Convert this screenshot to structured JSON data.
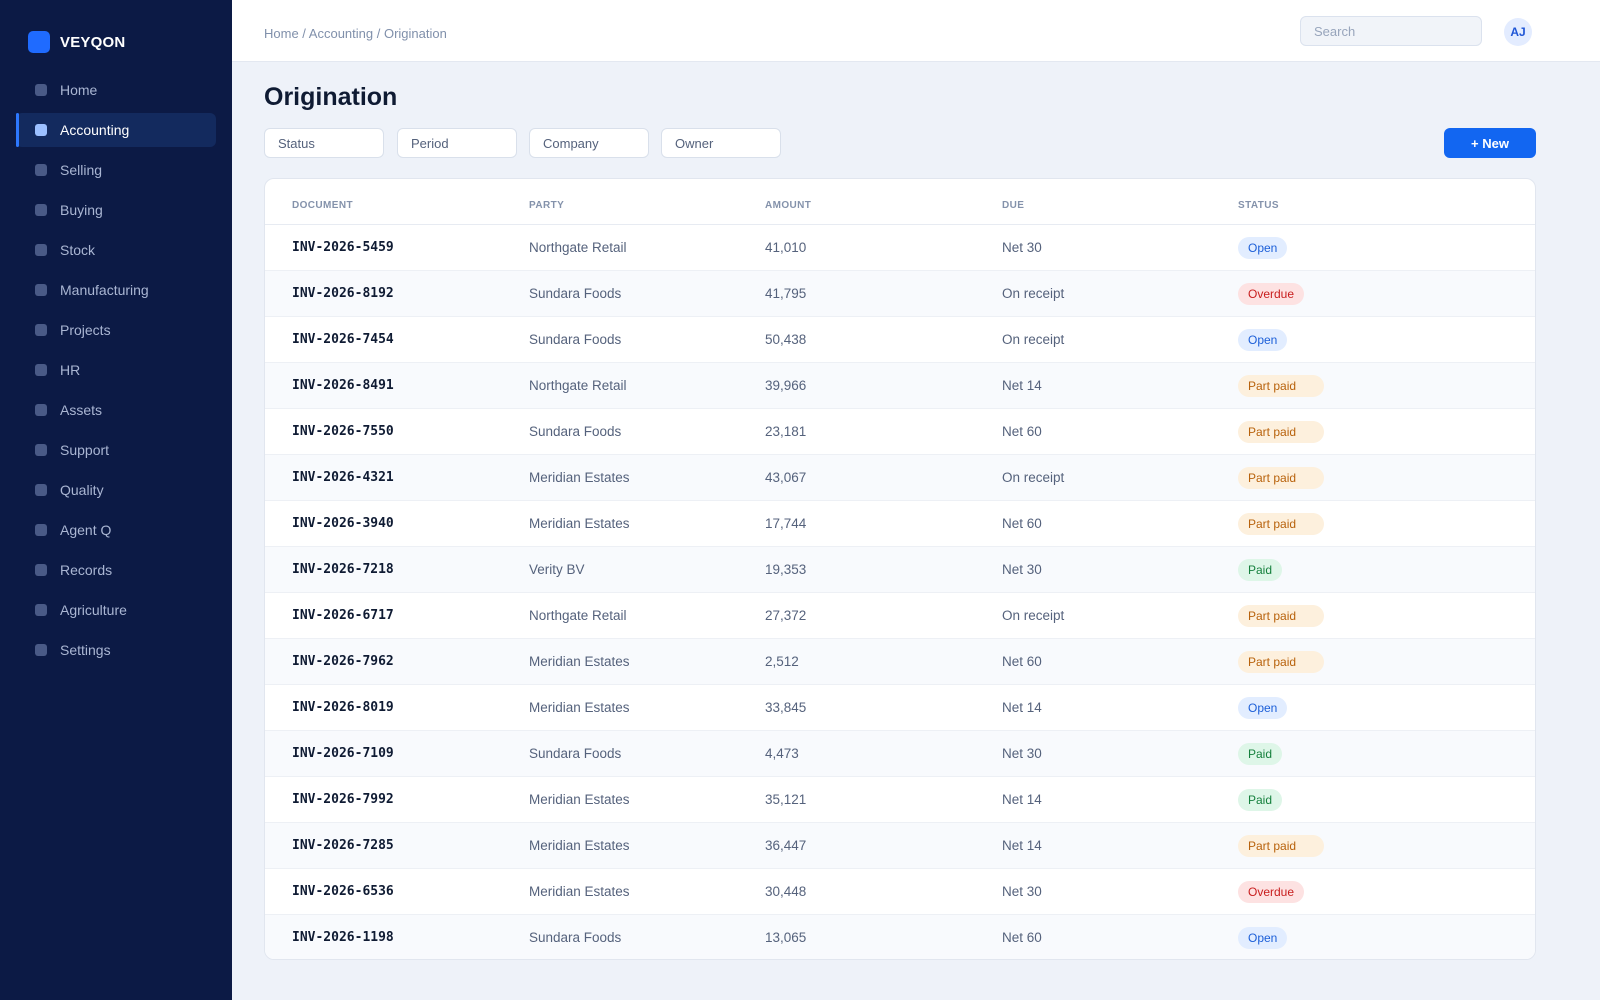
{
  "brand": {
    "name": "VEYQON",
    "accent": "#1f6bff"
  },
  "sidebar": {
    "active": "Accounting",
    "items": [
      {
        "label": "Home"
      },
      {
        "label": "Accounting"
      },
      {
        "label": "Selling"
      },
      {
        "label": "Buying"
      },
      {
        "label": "Stock"
      },
      {
        "label": "Manufacturing"
      },
      {
        "label": "Projects"
      },
      {
        "label": "HR"
      },
      {
        "label": "Assets"
      },
      {
        "label": "Support"
      },
      {
        "label": "Quality"
      },
      {
        "label": "Agent Q"
      },
      {
        "label": "Records"
      },
      {
        "label": "Agriculture"
      },
      {
        "label": "Settings"
      }
    ]
  },
  "header": {
    "breadcrumb": "Home / Accounting / Origination",
    "search_placeholder": "Search",
    "avatar_initials": "AJ"
  },
  "page": {
    "title": "Origination",
    "filters": [
      "Status",
      "Period",
      "Company",
      "Owner"
    ],
    "new_button": "+ New"
  },
  "table": {
    "columns": [
      "DOCUMENT",
      "PARTY",
      "AMOUNT",
      "DUE",
      "STATUS"
    ],
    "rows": [
      {
        "document": "INV-2026-5459",
        "party": "Northgate Retail",
        "amount": "41,010",
        "due": "Net 30",
        "status": "Open"
      },
      {
        "document": "INV-2026-8192",
        "party": "Sundara Foods",
        "amount": "41,795",
        "due": "On receipt",
        "status": "Overdue"
      },
      {
        "document": "INV-2026-7454",
        "party": "Sundara Foods",
        "amount": "50,438",
        "due": "On receipt",
        "status": "Open"
      },
      {
        "document": "INV-2026-8491",
        "party": "Northgate Retail",
        "amount": "39,966",
        "due": "Net 14",
        "status": "Part paid"
      },
      {
        "document": "INV-2026-7550",
        "party": "Sundara Foods",
        "amount": "23,181",
        "due": "Net 60",
        "status": "Part paid"
      },
      {
        "document": "INV-2026-4321",
        "party": "Meridian Estates",
        "amount": "43,067",
        "due": "On receipt",
        "status": "Part paid"
      },
      {
        "document": "INV-2026-3940",
        "party": "Meridian Estates",
        "amount": "17,744",
        "due": "Net 60",
        "status": "Part paid"
      },
      {
        "document": "INV-2026-7218",
        "party": "Verity BV",
        "amount": "19,353",
        "due": "Net 30",
        "status": "Paid"
      },
      {
        "document": "INV-2026-6717",
        "party": "Northgate Retail",
        "amount": "27,372",
        "due": "On receipt",
        "status": "Part paid"
      },
      {
        "document": "INV-2026-7962",
        "party": "Meridian Estates",
        "amount": "2,512",
        "due": "Net 60",
        "status": "Part paid"
      },
      {
        "document": "INV-2026-8019",
        "party": "Meridian Estates",
        "amount": "33,845",
        "due": "Net 14",
        "status": "Open"
      },
      {
        "document": "INV-2026-7109",
        "party": "Sundara Foods",
        "amount": "4,473",
        "due": "Net 30",
        "status": "Paid"
      },
      {
        "document": "INV-2026-7992",
        "party": "Meridian Estates",
        "amount": "35,121",
        "due": "Net 14",
        "status": "Paid"
      },
      {
        "document": "INV-2026-7285",
        "party": "Meridian Estates",
        "amount": "36,447",
        "due": "Net 14",
        "status": "Part paid"
      },
      {
        "document": "INV-2026-6536",
        "party": "Meridian Estates",
        "amount": "30,448",
        "due": "Net 30",
        "status": "Overdue"
      },
      {
        "document": "INV-2026-1198",
        "party": "Sundara Foods",
        "amount": "13,065",
        "due": "Net 60",
        "status": "Open"
      }
    ]
  },
  "status_colors": {
    "Open": "#1c5fd8",
    "Overdue": "#c81e1e",
    "Part paid": "#b8620c",
    "Paid": "#15803d"
  }
}
